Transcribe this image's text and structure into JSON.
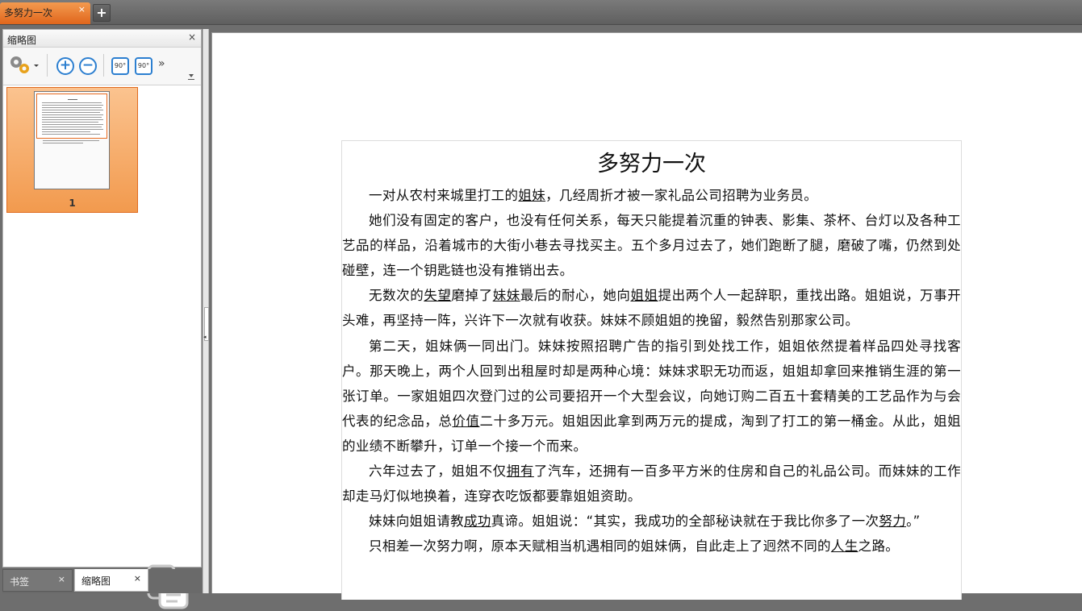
{
  "tabs": {
    "document_tab": "多努力一次",
    "close_glyph": "×",
    "new_tab_glyph": "+"
  },
  "panel": {
    "title": "缩略图",
    "close_glyph": "×",
    "toolbar": {
      "settings_icon": "gear-icon",
      "zoom_in_glyph": "+",
      "zoom_out_glyph": "−",
      "rotate_left_label": "90°",
      "rotate_right_label": "90°",
      "overflow_glyph": "»"
    },
    "thumbnail_page_number": "1"
  },
  "bottom_tabs": {
    "bookmarks": "书签",
    "thumbnails": "缩略图",
    "close_glyph": "×"
  },
  "document": {
    "title": "多努力一次",
    "paragraphs": [
      [
        {
          "t": "一对从农村来城里打工的"
        },
        {
          "t": "姐妹",
          "u": true
        },
        {
          "t": "，几经周折才被一家礼品公司招聘为业务员。"
        }
      ],
      [
        {
          "t": "她们没有固定的客户，也没有任何关系，每天只能提着沉重的钟表、影集、茶杯、台灯以及各种工艺品的样品，沿着城市的大街小巷去寻找买主。五个多月过去了，她们跑断了腿，磨破了嘴，仍然到处碰壁，连一个钥匙链也没有推销出去。"
        }
      ],
      [
        {
          "t": "无数次的"
        },
        {
          "t": "失望",
          "u": true
        },
        {
          "t": "磨掉了"
        },
        {
          "t": "妹妹",
          "u": true
        },
        {
          "t": "最后的耐心，她向"
        },
        {
          "t": "姐姐",
          "u": true
        },
        {
          "t": "提出两个人一起辞职，重找出路。姐姐说，万事开头难，再坚持一阵，兴许下一次就有收获。妹妹不顾姐姐的挽留，毅然告别那家公司。"
        }
      ],
      [
        {
          "t": "第二天，姐妹俩一同出门。妹妹按照招聘广告的指引到处找工作，姐姐依然提着样品四处寻找客户。那天晚上，两个人回到出租屋时却是两种心境：妹妹求职无功而返，姐姐却拿回来推销生涯的第一张订单。一家姐姐四次登门过的公司要招开一个大型会议，向她订购二百五十套精美的工艺品作为与会代表的纪念品，总"
        },
        {
          "t": "价值",
          "u": true
        },
        {
          "t": "二十多万元。姐姐因此拿到两万元的提成，淘到了打工的第一桶金。从此，姐姐的业绩不断攀升，订单一个接一个而来。"
        }
      ],
      [
        {
          "t": "六年过去了，姐姐不仅"
        },
        {
          "t": "拥有",
          "u": true
        },
        {
          "t": "了汽车，还拥有一百多平方米的住房和自己的礼品公司。而妹妹的工作却走马灯似地换着，连穿衣吃饭都要靠姐姐资助。"
        }
      ],
      [
        {
          "t": "妹妹向姐姐请教"
        },
        {
          "t": "成功",
          "u": true
        },
        {
          "t": "真谛。姐姐说：“其实，我成功的全部秘诀就在于我比你多了一次"
        },
        {
          "t": "努力",
          "u": true
        },
        {
          "t": "。”"
        }
      ],
      [
        {
          "t": "只相差一次努力啊，原本天赋相当机遇相同的姐妹俩，自此走上了迥然不同的"
        },
        {
          "t": "人生",
          "u": true
        },
        {
          "t": "之路。"
        }
      ]
    ]
  },
  "colors": {
    "accent_orange": "#e0661c",
    "icon_blue": "#2c7fd0",
    "chrome_gray": "#6e6e6e"
  }
}
